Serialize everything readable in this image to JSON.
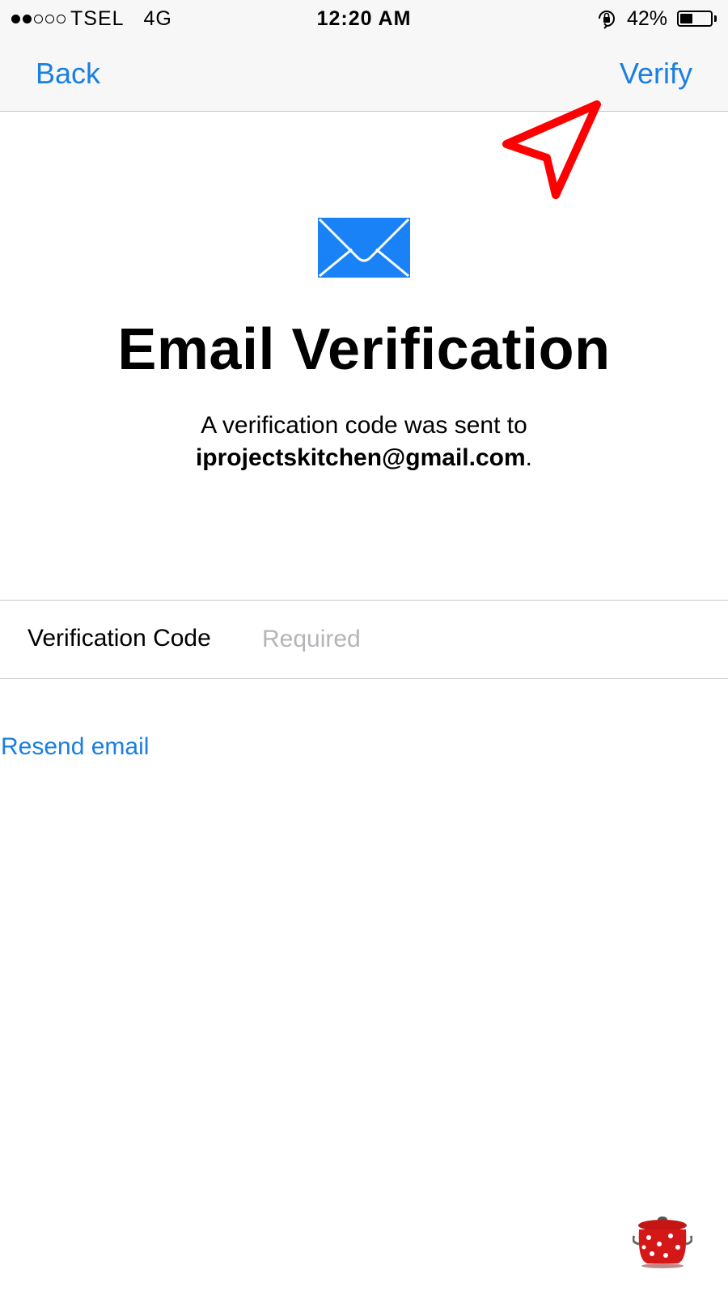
{
  "status_bar": {
    "carrier": "TSEL",
    "network": "4G",
    "time": "12:20 AM",
    "battery": "42%",
    "battery_level": 0.42,
    "signal_strength": 2,
    "signal_max": 5
  },
  "nav": {
    "back_label": "Back",
    "verify_label": "Verify"
  },
  "main": {
    "title": "Email Verification",
    "subtitle_line1": "A verification code was sent to",
    "email": "iprojectskitchen@gmail.com",
    "email_suffix": "."
  },
  "form": {
    "field_label": "Verification Code",
    "field_placeholder": "Required",
    "field_value": ""
  },
  "resend_label": "Resend email",
  "colors": {
    "accent": "#1a7fe0",
    "envelope": "#1a82f7",
    "annotation": "#ff0000",
    "bar_background": "#f7f7f7"
  },
  "icons": {
    "envelope": "envelope-icon",
    "arrow": "annotation-arrow-icon",
    "rotation_lock": "rotation-lock-icon",
    "battery": "battery-icon",
    "pot": "pot-sticker-icon"
  }
}
